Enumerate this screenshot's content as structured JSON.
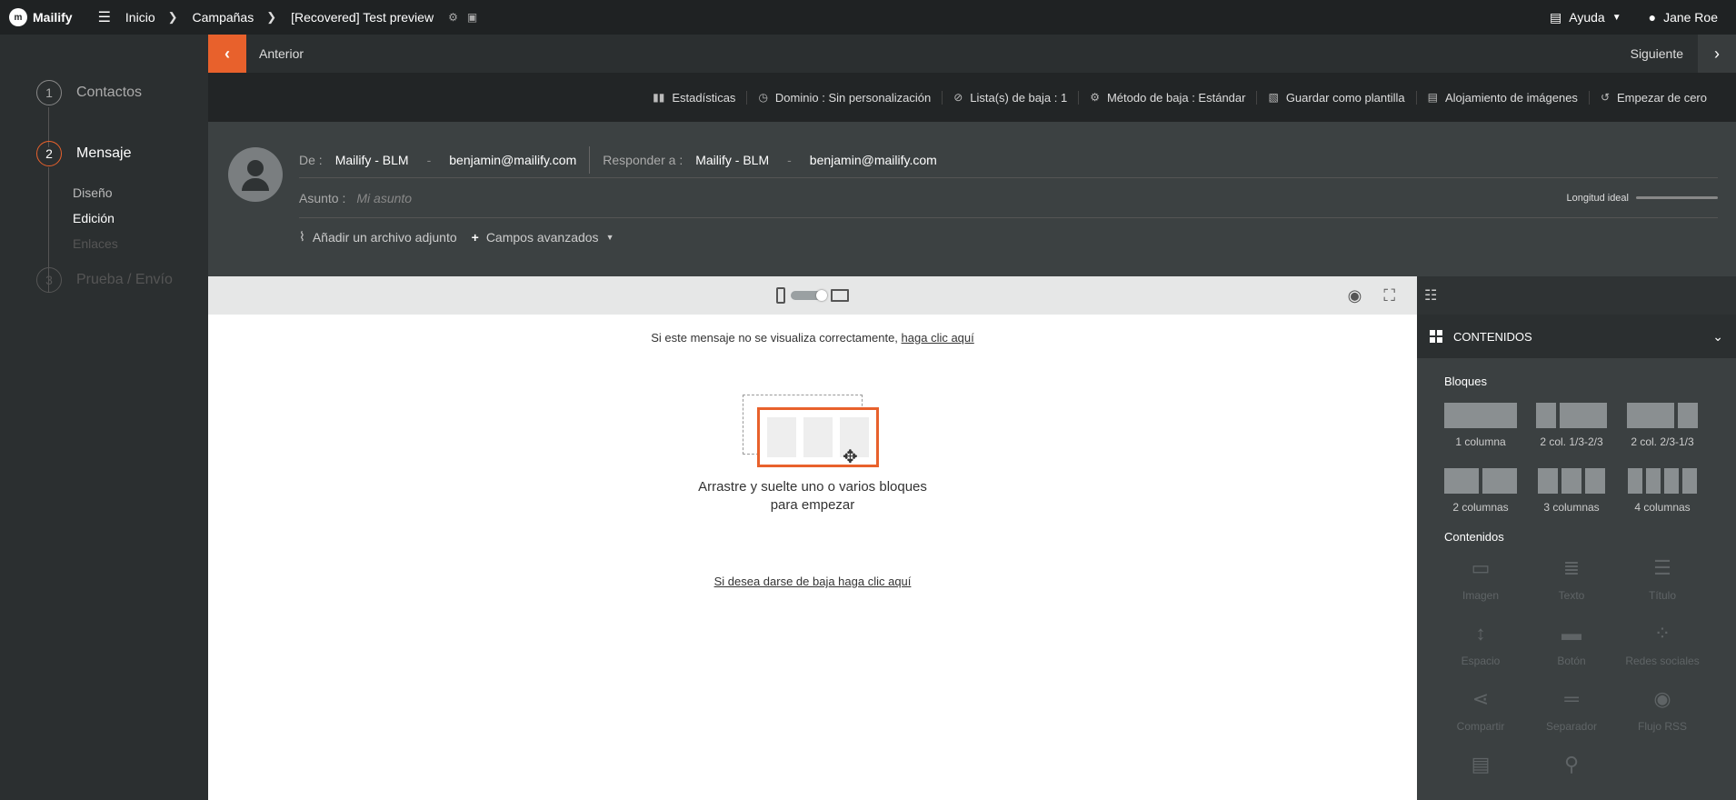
{
  "topbar": {
    "brand": "Mailify",
    "breadcrumb": [
      "Inicio",
      "Campañas",
      "[Recovered] Test preview"
    ],
    "help": "Ayuda",
    "user": "Jane Roe"
  },
  "steps": [
    {
      "num": "1",
      "label": "Contactos"
    },
    {
      "num": "2",
      "label": "Mensaje"
    },
    {
      "num": "3",
      "label": "Prueba / Envío"
    }
  ],
  "substeps": [
    "Diseño",
    "Edición",
    "Enlaces"
  ],
  "nav": {
    "prev": "Anterior",
    "next": "Siguiente"
  },
  "tools": [
    {
      "icon": "stats-icon",
      "label": "Estadísticas"
    },
    {
      "icon": "clock-icon",
      "label": "Dominio : Sin personalización"
    },
    {
      "icon": "ban-icon",
      "label": "Lista(s) de baja : 1"
    },
    {
      "icon": "gear-icon",
      "label": "Método de baja : Estándar"
    },
    {
      "icon": "template-icon",
      "label": "Guardar como plantilla"
    },
    {
      "icon": "images-icon",
      "label": "Alojamiento de imágenes"
    },
    {
      "icon": "history-icon",
      "label": "Empezar de cero"
    }
  ],
  "header": {
    "from_label": "De :",
    "from_name": "Mailify - BLM",
    "from_email": "benjamin@mailify.com",
    "reply_label": "Responder a :",
    "reply_name": "Mailify - BLM",
    "reply_email": "benjamin@mailify.com",
    "dash": "-",
    "subject_label": "Asunto :",
    "subject_placeholder": "Mi asunto",
    "ideal_length": "Longitud ideal",
    "attach": "Añadir un archivo adjunto",
    "advanced": "Campos avanzados"
  },
  "canvas": {
    "view_text": "Si este mensaje no se visualiza correctamente,",
    "view_link": "haga clic aquí",
    "drop_line1": "Arrastre y suelte uno o varios bloques",
    "drop_line2": "para empezar",
    "unsubscribe": "Si desea darse de baja haga clic aquí"
  },
  "panel": {
    "title": "CONTENIDOS",
    "blocks_title": "Bloques",
    "blocks": [
      "1 columna",
      "2 col. 1/3-2/3",
      "2 col. 2/3-1/3",
      "2 columnas",
      "3 columnas",
      "4 columnas"
    ],
    "contents_title": "Contenidos",
    "contents": [
      {
        "label": "Imagen",
        "icon": "▭"
      },
      {
        "label": "Texto",
        "icon": "≣"
      },
      {
        "label": "Título",
        "icon": "☰"
      },
      {
        "label": "Espacio",
        "icon": "↕"
      },
      {
        "label": "Botón",
        "icon": "▬"
      },
      {
        "label": "Redes sociales",
        "icon": "⁘"
      },
      {
        "label": "Compartir",
        "icon": "⋖"
      },
      {
        "label": "Separador",
        "icon": "═"
      },
      {
        "label": "Flujo RSS",
        "icon": "◉"
      },
      {
        "label": "",
        "icon": "▤"
      },
      {
        "label": "",
        "icon": "⚲"
      }
    ]
  }
}
